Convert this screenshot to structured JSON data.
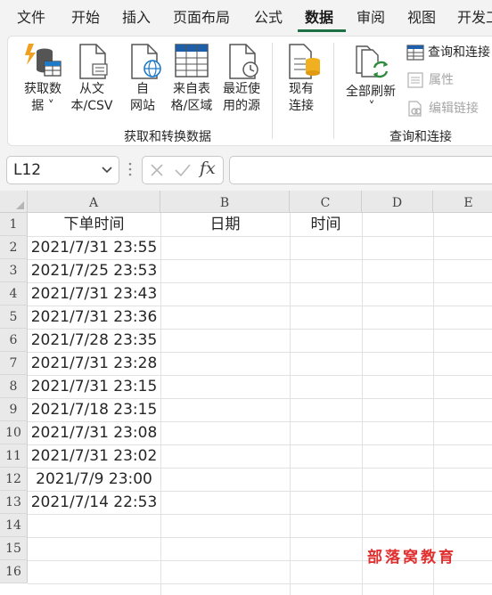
{
  "menu": {
    "tabs": [
      "文件",
      "开始",
      "插入",
      "页面布局",
      "公式",
      "数据",
      "审阅",
      "视图",
      "开发工"
    ],
    "active": "数据"
  },
  "ribbon": {
    "get_transform": {
      "title": "获取和转换数据",
      "buttons": [
        {
          "line1": "获取数",
          "line2": "据 ˅"
        },
        {
          "line1": "从文",
          "line2": "本/CSV"
        },
        {
          "line1": "自",
          "line2": "网站"
        },
        {
          "line1": "来自表",
          "line2": "格/区域"
        },
        {
          "line1": "最近使",
          "line2": "用的源"
        },
        {
          "line1": "现有",
          "line2": "连接"
        }
      ]
    },
    "queries": {
      "title": "查询和连接",
      "refresh_label": "全部刷新",
      "refresh_caret": "˅",
      "queries_connections": "查询和连接",
      "properties": "属性",
      "edit_links": "编辑链接"
    }
  },
  "formula_bar": {
    "name_box": "L12",
    "fx_label": "fx",
    "formula": ""
  },
  "sheet": {
    "columns": [
      "A",
      "B",
      "C",
      "D",
      "E"
    ],
    "rows": [
      "1",
      "2",
      "3",
      "4",
      "5",
      "6",
      "7",
      "8",
      "9",
      "10",
      "11",
      "12",
      "13",
      "14",
      "15",
      "16"
    ],
    "headers": {
      "a": "下单时间",
      "b": "日期",
      "c": "时间"
    },
    "order_times": [
      "2021/7/31 23:55",
      "2021/7/25 23:53",
      "2021/7/31 23:43",
      "2021/7/31 23:36",
      "2021/7/28 23:35",
      "2021/7/31 23:28",
      "2021/7/31 23:15",
      "2021/7/18 23:15",
      "2021/7/31 23:08",
      "2021/7/31 23:02",
      "2021/7/9 23:00",
      "2021/7/14 22:53"
    ],
    "watermark": "部落窝教育"
  },
  "colors": {
    "accent": "#1e7145",
    "watermark": "#e03030"
  }
}
